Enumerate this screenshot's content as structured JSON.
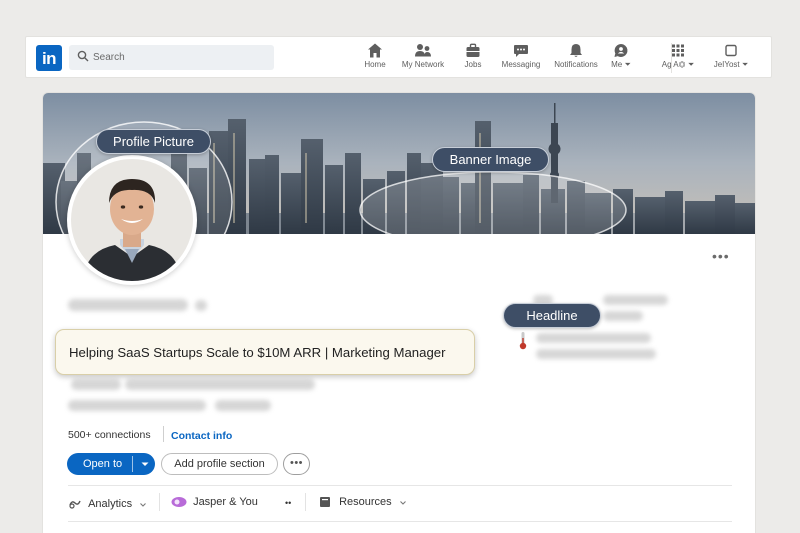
{
  "nav": {
    "logo": "in",
    "search_placeholder": "Search",
    "items": [
      {
        "label": "Home",
        "icon": "home-icon"
      },
      {
        "label": "My Network",
        "icon": "network-icon"
      },
      {
        "label": "Jobs",
        "icon": "briefcase-icon"
      },
      {
        "label": "Messaging",
        "icon": "message-icon"
      },
      {
        "label": "Notifications",
        "icon": "bell-icon"
      },
      {
        "label": "Me ⏷",
        "icon": "me-icon"
      },
      {
        "label": "Ag A⏣ ⏷",
        "icon": "grid-icon"
      },
      {
        "label": "JeIYost ⏷",
        "icon": "square-icon"
      }
    ]
  },
  "profile": {
    "headline": "Helping SaaS Startups Scale to $10M ARR | Marketing Manager",
    "connections": "500+ connections",
    "contact_info": "Contact info",
    "open_to": "Open to",
    "add_section": "Add profile section",
    "more": "•••",
    "card_more": "•••"
  },
  "toolbar": {
    "analytics": "Analytics",
    "jasper": "Jasper & You",
    "dots": "••",
    "resources": "Resources"
  },
  "callouts": {
    "profile_picture": "Profile Picture",
    "banner_image": "Banner Image",
    "headline": "Headline"
  },
  "colors": {
    "brand": "#0a66c2",
    "callout_bg": "#3e4e66",
    "headline_box": "#fbf8ee"
  }
}
